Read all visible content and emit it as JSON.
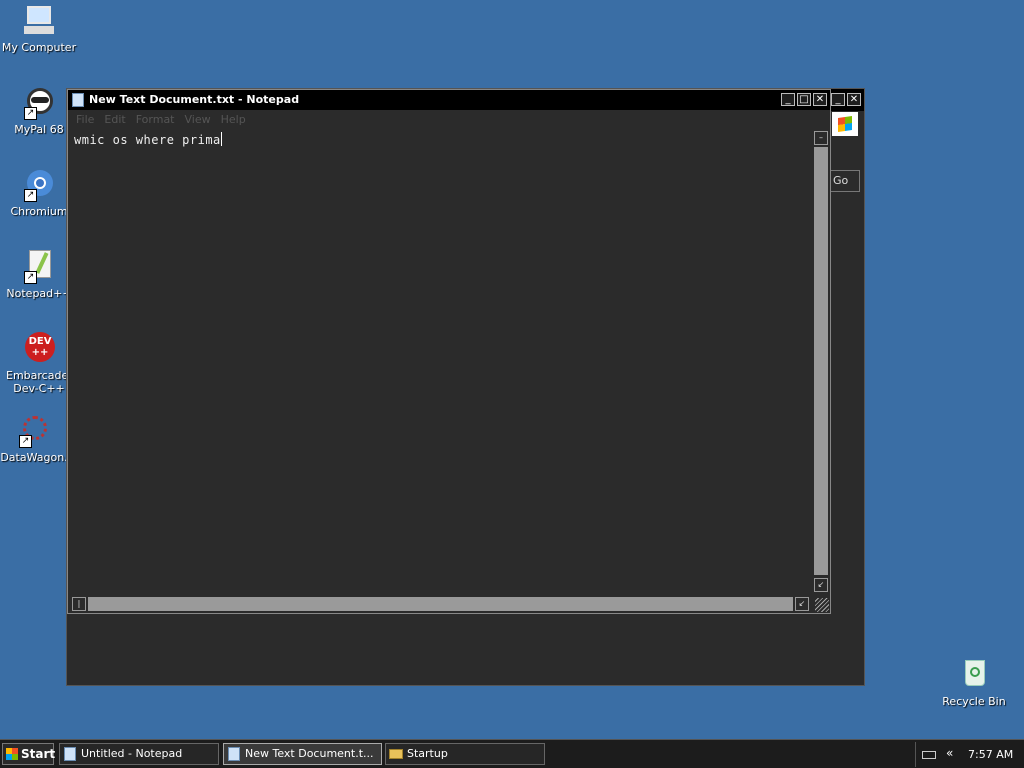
{
  "desktop": {
    "icons": [
      {
        "label": "My Computer",
        "icon": "computer-icon"
      },
      {
        "label": "MyPal 68",
        "icon": "raccoon-browser-icon"
      },
      {
        "label": "Chromium",
        "icon": "chromium-icon"
      },
      {
        "label": "Notepad++",
        "icon": "notepadpp-icon"
      },
      {
        "label": "Embarcadero Dev-C++",
        "icon": "devcpp-icon"
      },
      {
        "label": "DataWagon.",
        "icon": "datawagon-icon"
      },
      {
        "label": "Recycle Bin",
        "icon": "recycle-bin-icon"
      }
    ]
  },
  "background_window": {
    "go_label": "Go"
  },
  "notepad": {
    "title": "New Text Document.txt - Notepad",
    "menu": [
      "File",
      "Edit",
      "Format",
      "View",
      "Help"
    ],
    "content": "wmic os where prima"
  },
  "taskbar": {
    "start_label": "Start",
    "tasks": [
      {
        "label": "Untitled - Notepad",
        "active": false
      },
      {
        "label": "New Text Document.t...",
        "active": true
      },
      {
        "label": "Startup",
        "active": false
      }
    ],
    "tray": {
      "chevron": "«",
      "clock": "7:57 AM"
    }
  },
  "colors": {
    "desktop": "#3a6ea5",
    "window_bg": "#2b2b2b",
    "titlebar": "#000000"
  }
}
